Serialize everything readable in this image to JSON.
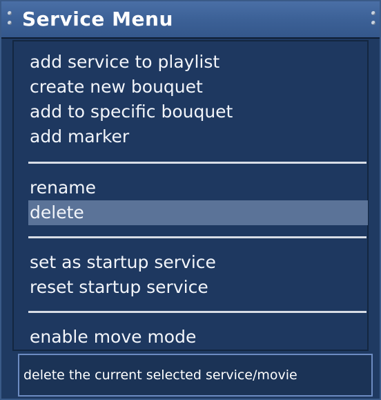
{
  "window": {
    "title": "Service Menu"
  },
  "menu": {
    "groups": [
      {
        "items": [
          {
            "label": "add service to playlist"
          },
          {
            "label": "create new bouquet"
          },
          {
            "label": "add to specific bouquet"
          },
          {
            "label": "add marker"
          }
        ]
      },
      {
        "items": [
          {
            "label": "rename"
          },
          {
            "label": "delete",
            "selected": true
          }
        ]
      },
      {
        "items": [
          {
            "label": "set as startup service"
          },
          {
            "label": "reset startup service"
          }
        ]
      },
      {
        "items": [
          {
            "label": "enable move mode"
          }
        ]
      }
    ]
  },
  "status": {
    "text": "delete the current selected service/movie"
  },
  "colors": {
    "background": "#1f3a62",
    "titlebar": "#3d6298",
    "selection": "#5b7398",
    "text": "#ffffff",
    "status_border": "#6d8cc2"
  }
}
